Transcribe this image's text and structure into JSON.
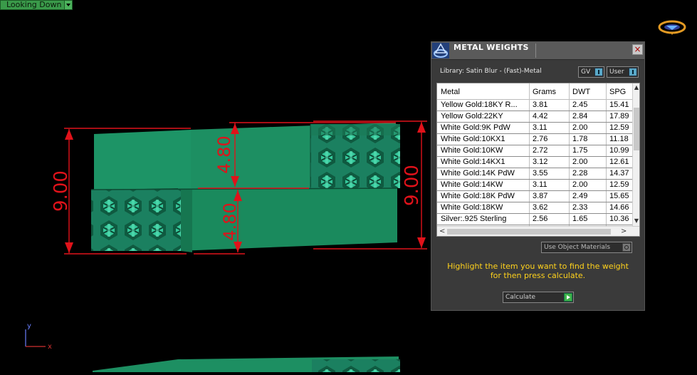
{
  "view_mode": {
    "label": "Looking Down"
  },
  "dimensions": {
    "left_height": "9.00",
    "right_height": "9.00",
    "upper_section": "4.80",
    "lower_section": "4.80"
  },
  "axes": {
    "y": "y",
    "x": "x"
  },
  "colors": {
    "model": "#1f8f63",
    "dimension": "#e0121a",
    "background": "#000000",
    "hint": "#ffd21c"
  },
  "panel": {
    "title": "METAL WEIGHTS",
    "close_icon": "×",
    "library_label": "Library: Satin Blur - (Fast)-Metal",
    "toggle_gv": "GV",
    "toggle_user": "User",
    "table": {
      "columns": [
        "Metal",
        "Grams",
        "DWT",
        "SPG"
      ],
      "rows": [
        [
          "Yellow Gold:18KY R...",
          "3.81",
          "2.45",
          "15.41"
        ],
        [
          "Yellow Gold:22KY",
          "4.42",
          "2.84",
          "17.89"
        ],
        [
          "White Gold:9K PdW",
          "3.11",
          "2.00",
          "12.59"
        ],
        [
          "White Gold:10KX1",
          "2.76",
          "1.78",
          "11.18"
        ],
        [
          "White Gold:10KW",
          "2.72",
          "1.75",
          "10.99"
        ],
        [
          "White Gold:14KX1",
          "3.12",
          "2.00",
          "12.61"
        ],
        [
          "White Gold:14K PdW",
          "3.55",
          "2.28",
          "14.37"
        ],
        [
          "White Gold:14KW",
          "3.11",
          "2.00",
          "12.59"
        ],
        [
          "White Gold:18K PdW",
          "3.87",
          "2.49",
          "15.65"
        ],
        [
          "White Gold:18KW",
          "3.62",
          "2.33",
          "14.66"
        ],
        [
          "Silver:.925 Sterling",
          "2.56",
          "1.65",
          "10.36"
        ]
      ]
    },
    "use_object_materials": "Use Object Materials",
    "hint_line1": "Highlight the item you want to find the weight",
    "hint_line2": "for then press calculate.",
    "calculate_label": "Calculate"
  }
}
